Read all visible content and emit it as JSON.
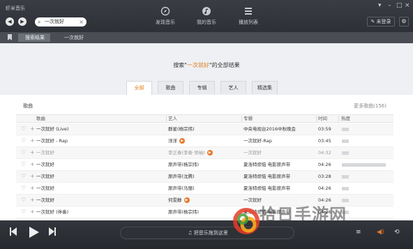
{
  "app": {
    "title": "虾米音乐"
  },
  "search": {
    "value": "一次就好"
  },
  "top_tabs": [
    {
      "label": "发现音乐",
      "icon": "compass-icon"
    },
    {
      "label": "我的音乐",
      "icon": "music-note-icon"
    },
    {
      "label": "播放列表",
      "icon": "playlist-icon"
    }
  ],
  "account": {
    "login_label": "未登录"
  },
  "breadcrumb": {
    "item1": "搜索结果",
    "item2": "一次就好"
  },
  "results": {
    "prefix": "搜索\"",
    "keyword": "一次就好",
    "suffix": "\"的全部结果"
  },
  "result_tabs": [
    "全部",
    "歌曲",
    "专辑",
    "艺人",
    "精选集"
  ],
  "section": {
    "label": "歌曲",
    "more": "更多歌曲(156)"
  },
  "table": {
    "headers": {
      "title": "歌曲",
      "artist": "艺人",
      "album": "专辑",
      "time": "时间",
      "heat": "热度"
    },
    "rows": [
      {
        "title": "一次就好 (Live)",
        "artist": "群星(杨宗纬)",
        "album": "中央电视台2016中秋晚会",
        "time": "03:59",
        "mv": false,
        "dim": false,
        "heat": 0.05
      },
      {
        "title": "一次就好 - Rap",
        "artist": "洋洋",
        "album": "一次就好-Rap",
        "time": "03:45",
        "mv": true,
        "dim": false,
        "heat": 0.05
      },
      {
        "title": "一次就好",
        "artist": "李正泰(李泰·领袖)",
        "album": "一次就好",
        "time": "04:32",
        "mv": true,
        "dim": true,
        "heat": 0.05
      },
      {
        "title": "一次就好",
        "artist": "原声带(杨宗纬)",
        "album": "夏洛特烦恼 电影原声带",
        "time": "04:26",
        "mv": false,
        "dim": false,
        "heat": 0.9
      },
      {
        "title": "一次就好",
        "artist": "原声带(沈腾)",
        "album": "夏洛特烦恼 电影原声带",
        "time": "03:28",
        "mv": false,
        "dim": false,
        "heat": 0.05
      },
      {
        "title": "一次就好",
        "artist": "原声带(马丽)",
        "album": "夏洛特烦恼 电影原声带",
        "time": "04:26",
        "mv": false,
        "dim": false,
        "heat": 0.05
      },
      {
        "title": "一次就好",
        "artist": "何雯静",
        "album": "一次就好",
        "time": "04:26",
        "mv": true,
        "dim": false,
        "heat": 0.05
      },
      {
        "title": "一次就好 (伴奏)",
        "artist": "原声带(杨宗纬)",
        "album": "夏洛特烦恼 电影原声带",
        "time": "04:26",
        "mv": false,
        "dim": false,
        "heat": 0.05
      }
    ]
  },
  "player": {
    "now_playing": "把音乐拖到这里"
  },
  "watermark": {
    "text": "拾日手游网"
  },
  "colors": {
    "accent": "#e07c1c",
    "topbar": "#2d3036",
    "mv_badge": "#e8792b"
  }
}
